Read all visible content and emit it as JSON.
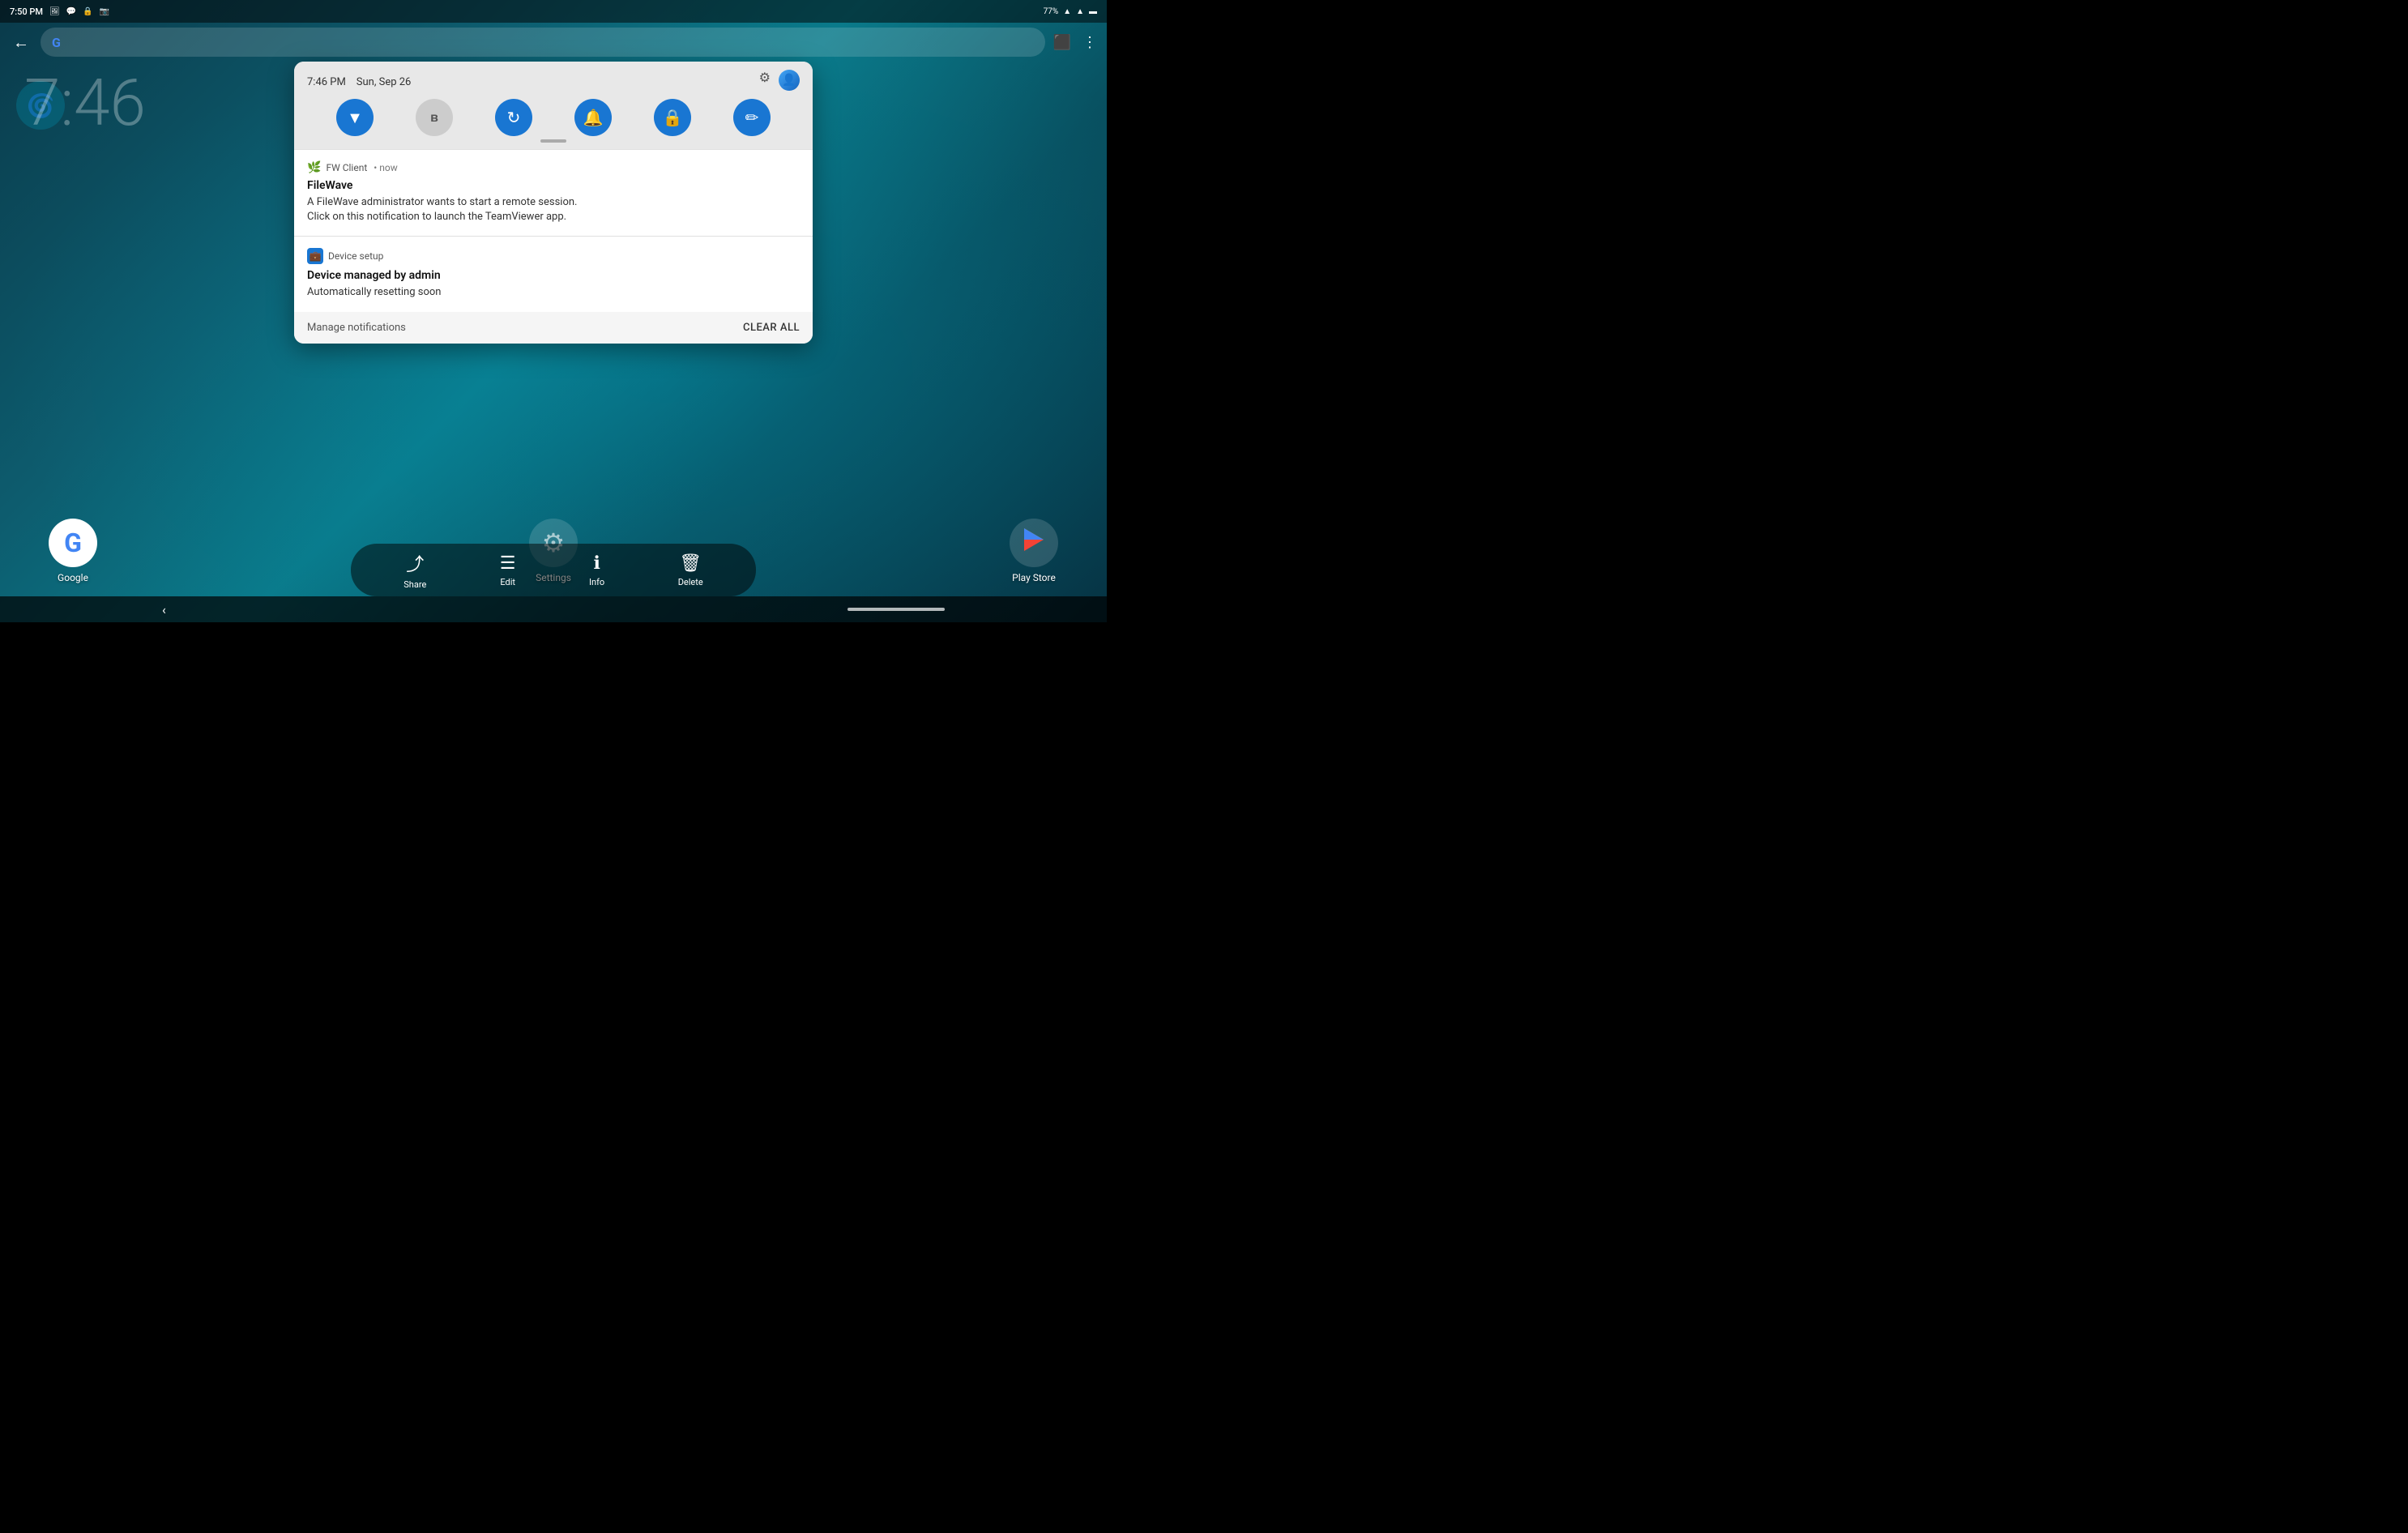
{
  "statusBar": {
    "time": "7:50 PM",
    "batteryPercent": "77%",
    "icons": [
      "photo-icon",
      "chat-icon",
      "lock-icon",
      "screenshot-icon"
    ]
  },
  "topNav": {
    "backLabel": "←",
    "searchPlaceholder": "",
    "rightIcons": [
      "cast-icon",
      "more-icon"
    ]
  },
  "clock": {
    "display": "7:46"
  },
  "quickSettings": {
    "time": "7:46 PM",
    "date": "Sun, Sep 26",
    "gearLabel": "⚙",
    "profileLabel": "👤",
    "icons": [
      {
        "name": "wifi-icon",
        "symbol": "▼",
        "active": true
      },
      {
        "name": "bluetooth-icon",
        "symbol": "ʙ",
        "active": false
      },
      {
        "name": "sync-icon",
        "symbol": "↻",
        "active": true
      },
      {
        "name": "bell-icon",
        "symbol": "🔔",
        "active": true
      },
      {
        "name": "lock-rotation-icon",
        "symbol": "🔒",
        "active": true
      },
      {
        "name": "edit-icon",
        "symbol": "✏",
        "active": true
      }
    ]
  },
  "notifications": [
    {
      "id": "fw-notification",
      "appIcon": "🌿",
      "appName": "FW Client",
      "timeSuffix": "• now",
      "title": "FileWave",
      "body": "A FileWave administrator wants to start a remote session.\nClick on this notification to launch the TeamViewer app."
    },
    {
      "id": "device-notification",
      "appIcon": "💼",
      "appName": "Device setup",
      "title": "Device managed by admin",
      "body": "Automatically resetting soon"
    }
  ],
  "notifFooter": {
    "manageLabel": "Manage notifications",
    "clearLabel": "CLEAR ALL"
  },
  "desktopIcons": [
    {
      "name": "google-icon",
      "label": "Google",
      "symbol": "G"
    },
    {
      "name": "settings-icon",
      "label": "Settings",
      "symbol": "⚙"
    },
    {
      "name": "playstore-icon",
      "label": "Play Store",
      "symbol": "▶"
    }
  ],
  "actionBar": {
    "items": [
      {
        "name": "share-action",
        "icon": "⤴",
        "label": "Share"
      },
      {
        "name": "edit-action",
        "icon": "≡",
        "label": "Edit"
      },
      {
        "name": "info-action",
        "icon": "ℹ",
        "label": "Info"
      },
      {
        "name": "delete-action",
        "icon": "🗑",
        "label": "Delete"
      }
    ]
  },
  "bottomNav": {
    "backSymbol": "‹"
  }
}
